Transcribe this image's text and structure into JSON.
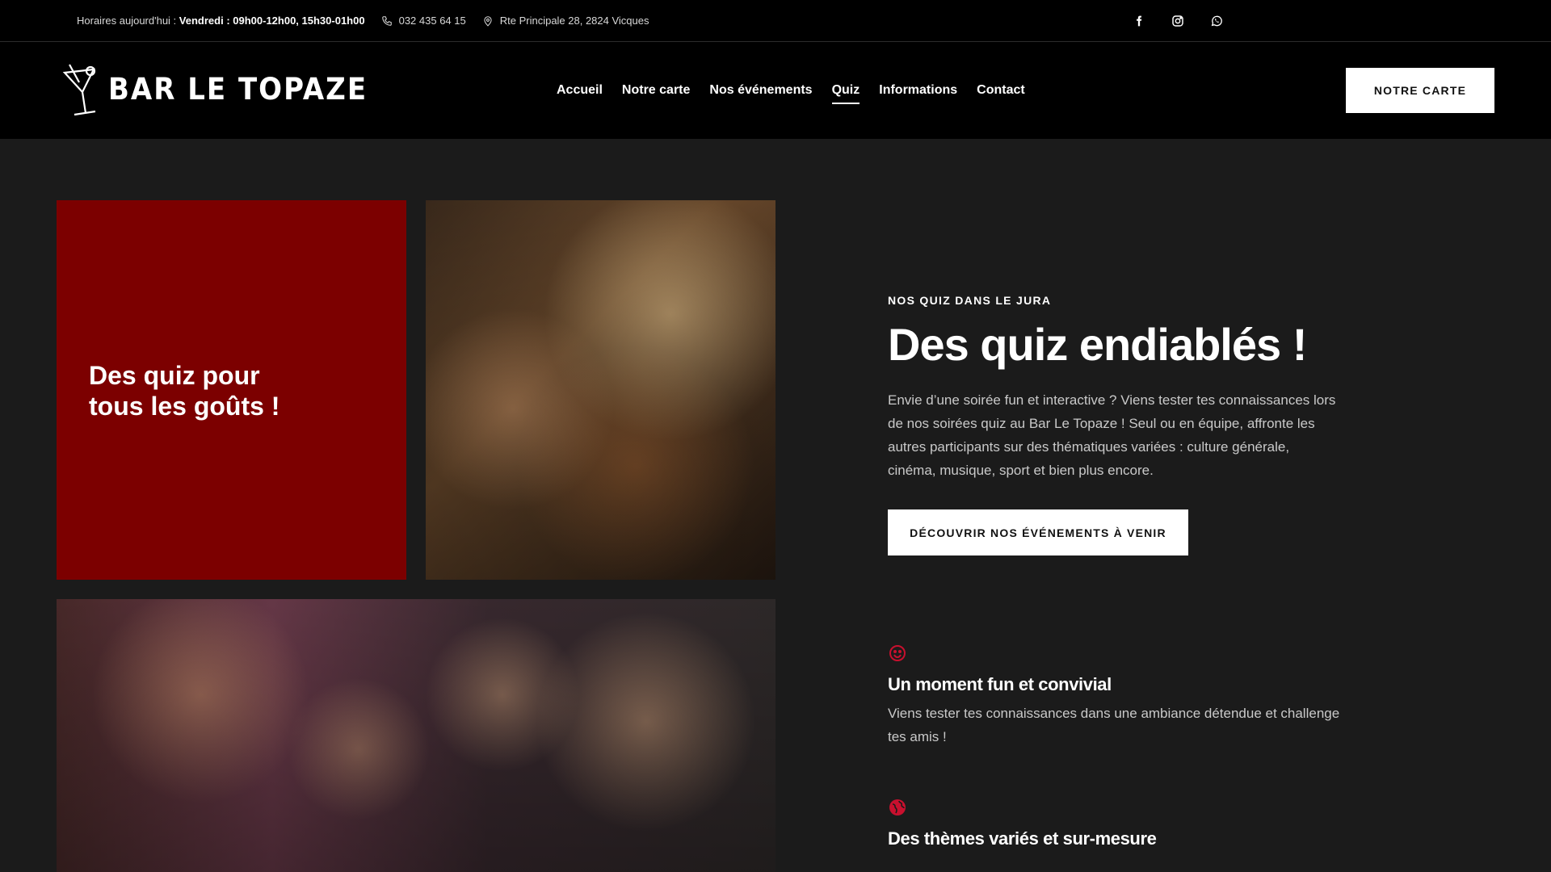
{
  "topbar": {
    "hours_prefix": "Horaires aujourd'hui :",
    "hours_value": "Vendredi : 09h00-12h00, 15h30-01h00",
    "phone": "032 435 64 15",
    "address": "Rte Principale 28, 2824 Vicques",
    "social": [
      "facebook-icon",
      "instagram-icon",
      "whatsapp-icon"
    ]
  },
  "header": {
    "brand": "BAR LE TOPAZE",
    "nav": [
      {
        "label": "Accueil"
      },
      {
        "label": "Notre carte"
      },
      {
        "label": "Nos événements"
      },
      {
        "label": "Quiz",
        "active": true
      },
      {
        "label": "Informations"
      },
      {
        "label": "Contact"
      }
    ],
    "cta": "NOTRE CARTE"
  },
  "hero": {
    "card_text": "Des quiz pour tous les goûts !",
    "eyebrow": "NOS QUIZ DANS LE JURA",
    "title": "Des quiz endiablés !",
    "lead": "Envie d’une soirée fun et interactive ? Viens tester tes connaissances lors de nos soirées quiz au Bar Le Topaze ! Seul ou en équipe, affronte les autres participants sur des thématiques variées : culture générale, cinéma, musique, sport et bien plus encore.",
    "cta": "DÉCOUVRIR NOS ÉVÉNEMENTS À VENIR",
    "features": [
      {
        "icon": "smiley-icon",
        "title": "Un moment fun et convivial",
        "text": "Viens tester tes connaissances dans une ambiance détendue et challenge tes amis !"
      },
      {
        "icon": "globe-icon",
        "title": "Des thèmes variés et sur-mesure",
        "text": ""
      }
    ]
  },
  "colors": {
    "accent_red": "#7c0000",
    "icon_red": "#c8102e",
    "background": "#1b1b1b",
    "header_bg": "#000000"
  }
}
